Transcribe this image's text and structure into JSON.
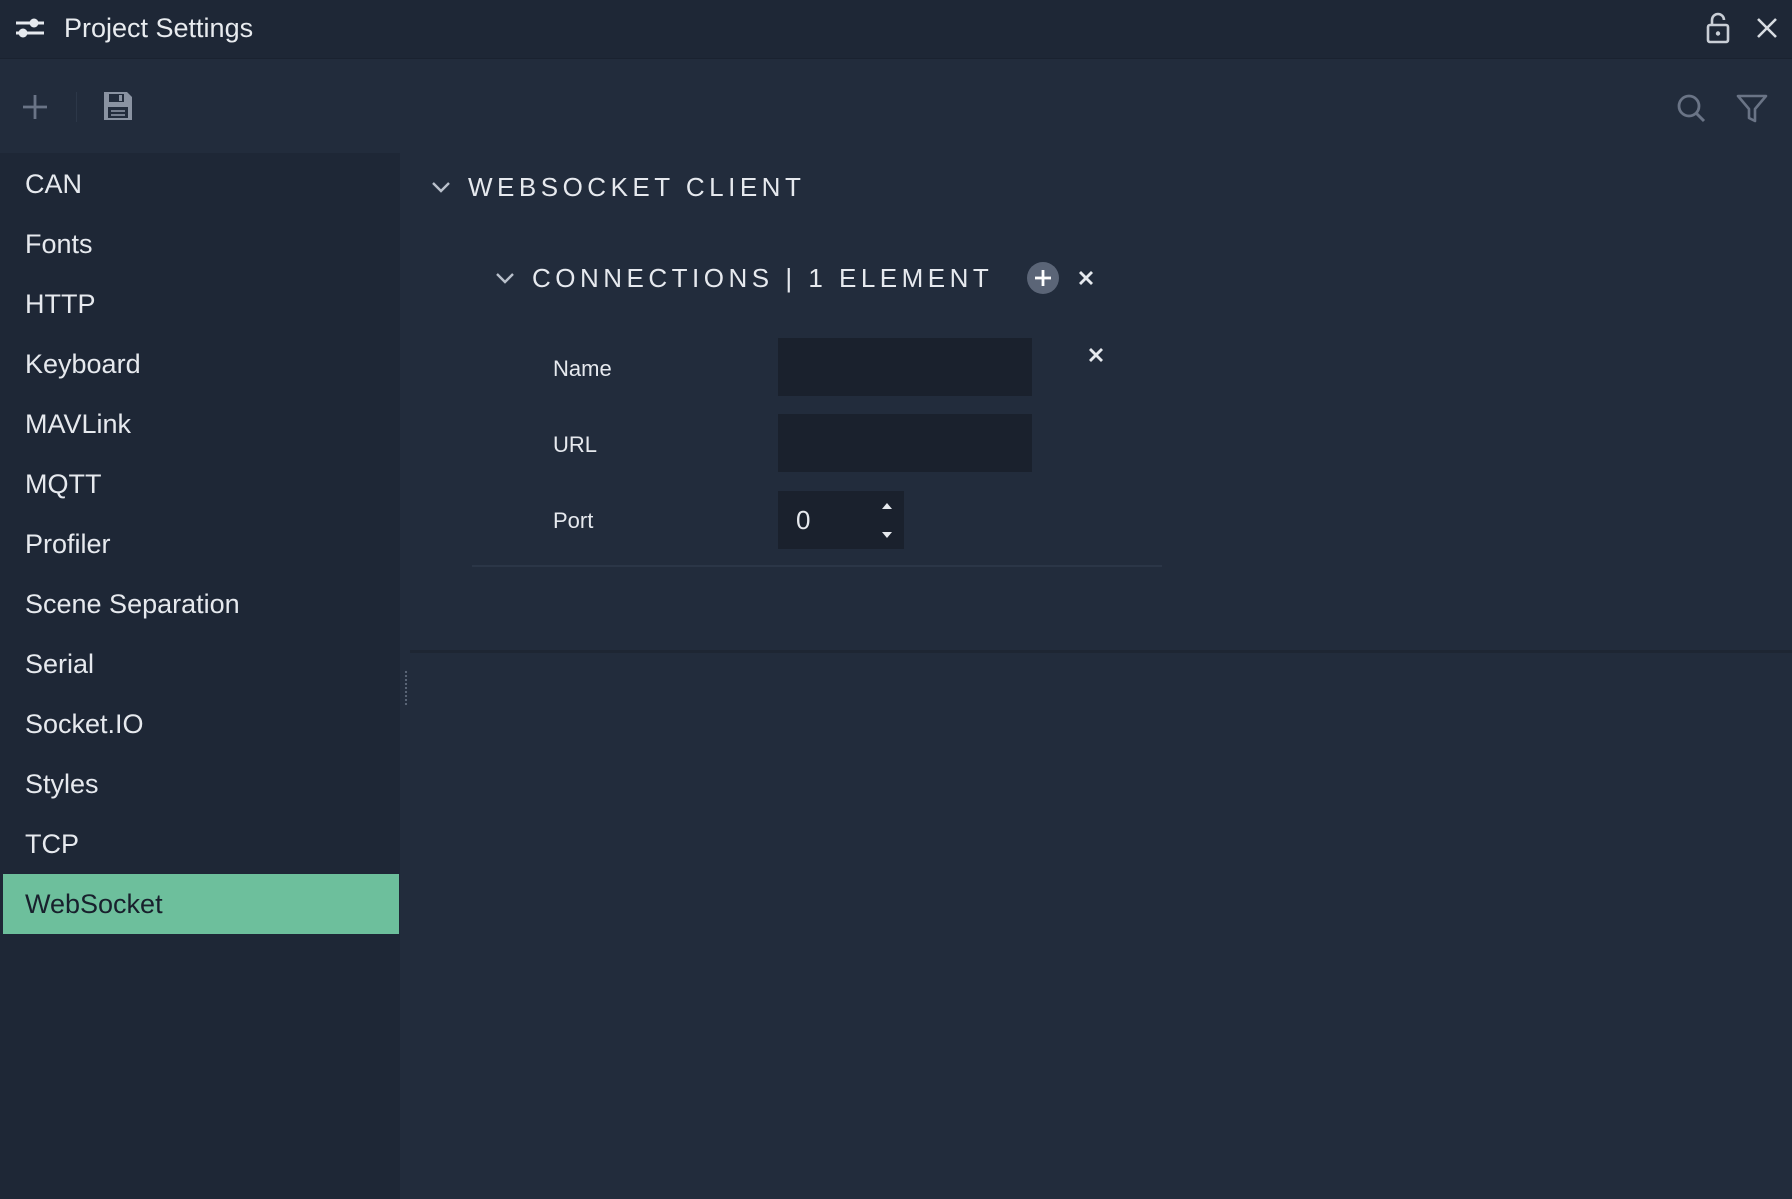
{
  "window": {
    "title": "Project Settings",
    "icons": {
      "app": "settings-sliders-icon",
      "lock": "lock-icon",
      "close": "close-icon"
    }
  },
  "toolbar": {
    "icons": {
      "add": "plus-icon",
      "save": "floppy-disk-icon",
      "search": "search-icon",
      "filter": "filter-icon"
    }
  },
  "sidebar": {
    "items": [
      {
        "label": "CAN",
        "active": false
      },
      {
        "label": "Fonts",
        "active": false
      },
      {
        "label": "HTTP",
        "active": false
      },
      {
        "label": "Keyboard",
        "active": false
      },
      {
        "label": "MAVLink",
        "active": false
      },
      {
        "label": "MQTT",
        "active": false
      },
      {
        "label": "Profiler",
        "active": false
      },
      {
        "label": "Scene Separation",
        "active": false
      },
      {
        "label": "Serial",
        "active": false
      },
      {
        "label": "Socket.IO",
        "active": false
      },
      {
        "label": "Styles",
        "active": false
      },
      {
        "label": "TCP",
        "active": false
      },
      {
        "label": "WebSocket",
        "active": true
      }
    ],
    "active_color": "#6dbf9c"
  },
  "main": {
    "section_title": "WEBSOCKET CLIENT",
    "connections": {
      "title": "CONNECTIONS | 1 ELEMENT",
      "fields": {
        "name_label": "Name",
        "name_value": "",
        "url_label": "URL",
        "url_value": "",
        "port_label": "Port",
        "port_value": "0"
      }
    }
  },
  "colors": {
    "background": "#222c3c",
    "sidebar": "#1e2736",
    "input": "#1a212d",
    "text": "#e6e9ee"
  }
}
